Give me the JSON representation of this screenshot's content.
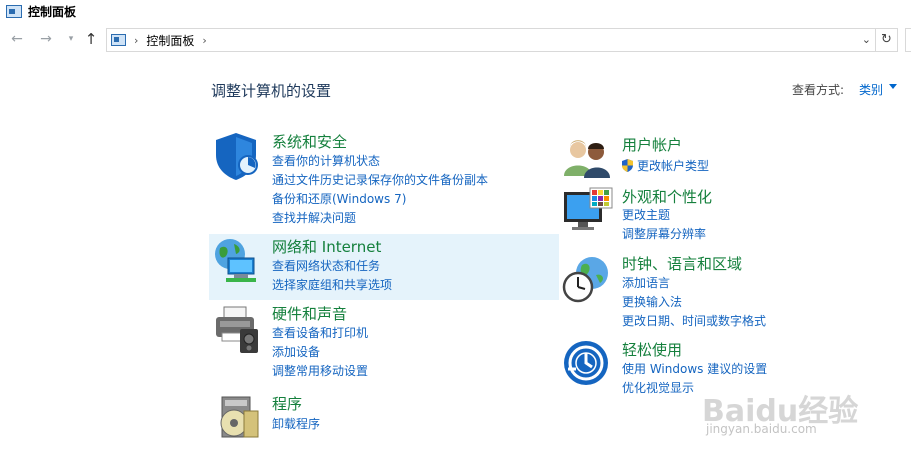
{
  "window": {
    "title": "控制面板"
  },
  "address": {
    "crumb": "控制面板"
  },
  "header": {
    "heading": "调整计算机的设置",
    "view_by_label": "查看方式:",
    "view_by_value": "类别"
  },
  "left": [
    {
      "id": "system-security",
      "icon": "shield-icon",
      "title": "系统和安全",
      "links": [
        "查看你的计算机状态",
        "通过文件历史记录保存你的文件备份副本",
        "备份和还原(Windows 7)",
        "查找并解决问题"
      ]
    },
    {
      "id": "network-internet",
      "icon": "network-globe-icon",
      "title": "网络和 Internet",
      "links": [
        "查看网络状态和任务",
        "选择家庭组和共享选项"
      ]
    },
    {
      "id": "hardware-sound",
      "icon": "printer-icon",
      "title": "硬件和声音",
      "links": [
        "查看设备和打印机",
        "添加设备",
        "调整常用移动设置"
      ]
    },
    {
      "id": "programs",
      "icon": "programs-disc-icon",
      "title": "程序",
      "links": [
        "卸载程序"
      ]
    }
  ],
  "right": [
    {
      "id": "user-accounts",
      "icon": "users-icon",
      "title": "用户帐户",
      "links": [
        "更改帐户类型"
      ]
    },
    {
      "id": "appearance",
      "icon": "monitor-palette-icon",
      "title": "外观和个性化",
      "links": [
        "更改主题",
        "调整屏幕分辨率"
      ]
    },
    {
      "id": "clock-region",
      "icon": "clock-globe-icon",
      "title": "时钟、语言和区域",
      "links": [
        "添加语言",
        "更换输入法",
        "更改日期、时间或数字格式"
      ]
    },
    {
      "id": "ease-of-access",
      "icon": "ease-of-access-icon",
      "title": "轻松使用",
      "links": [
        "使用 Windows 建议的设置",
        "优化视觉显示"
      ]
    }
  ],
  "watermark": {
    "text": "Baidu经验",
    "sub": "jingyan.baidu.com"
  }
}
